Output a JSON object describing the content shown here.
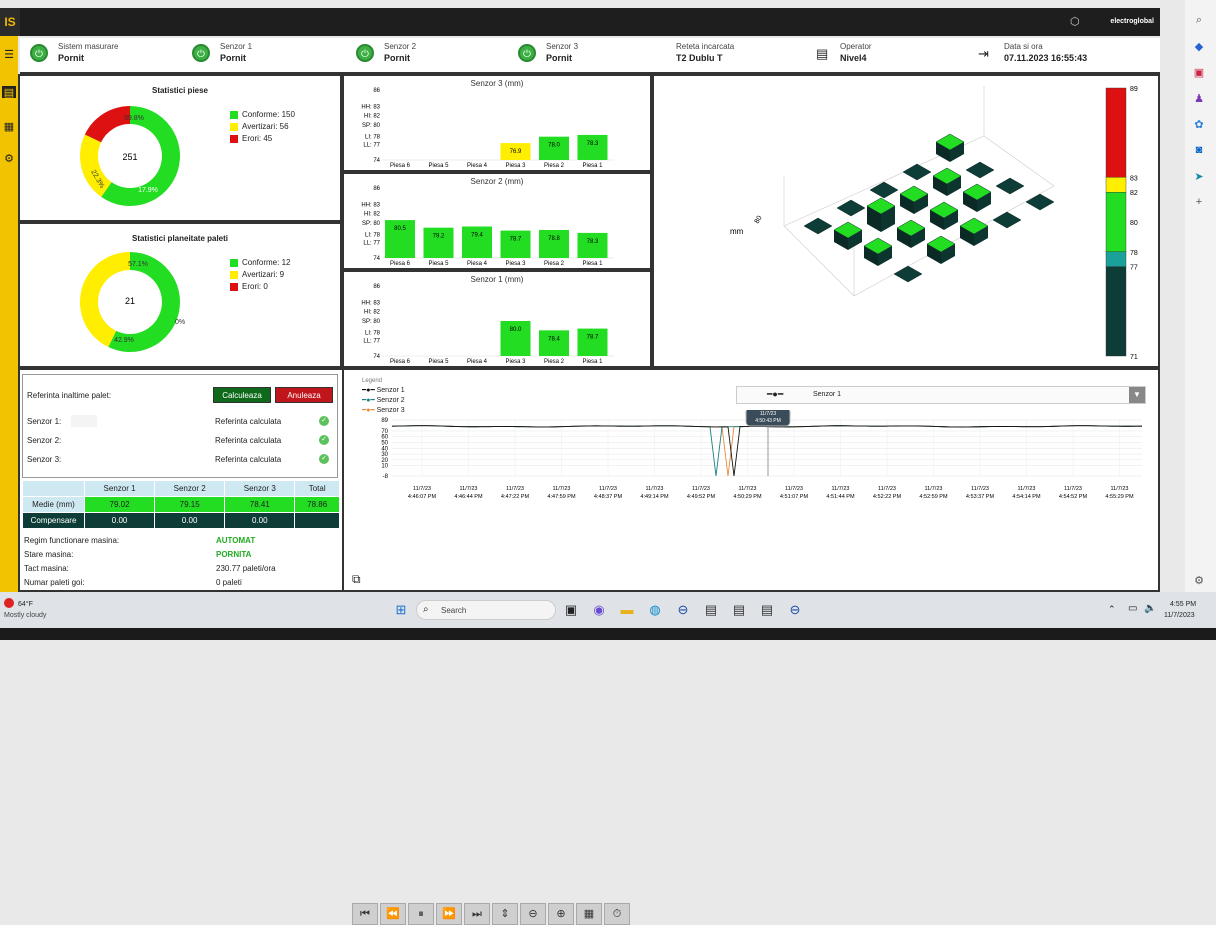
{
  "app": {
    "logo": "IS",
    "brand": "electroglobal"
  },
  "status": [
    {
      "label": "Sistem masurare",
      "value": "Pornit"
    },
    {
      "label": "Senzor 1",
      "value": "Pornit"
    },
    {
      "label": "Senzor 2",
      "value": "Pornit"
    },
    {
      "label": "Senzor 3",
      "value": "Pornit"
    },
    {
      "label": "Reteta incarcata",
      "value": "T2 Dublu T"
    },
    {
      "label": "Operator",
      "value": "Nivel4"
    },
    {
      "label": "Data si ora",
      "value": "07.11.2023 16:55:43"
    }
  ],
  "piese": {
    "title": "Statistici piese",
    "total": "251",
    "p1": "59.8%",
    "p2": "22.3%",
    "p3": "17.9%",
    "legend": [
      "Conforme: 150",
      "Avertizari: 56",
      "Erori: 45"
    ]
  },
  "paleti": {
    "title": "Statistici planeitate paleti",
    "total": "21",
    "p1": "57.1%",
    "p2": "42.9%",
    "p3": "0%",
    "legend": [
      "Conforme: 12",
      "Avertizari: 9",
      "Erori: 0"
    ]
  },
  "colors": {
    "green": "#22dd22",
    "yellow": "#ffee00",
    "red": "#dd1111",
    "dark": "#0d3d36",
    "teal": "#1aa19a"
  },
  "bars": {
    "yticks": [
      "86",
      "HH: 83",
      "HI: 82",
      "SP: 80",
      "LI: 78",
      "LL: 77",
      "74"
    ],
    "categories": [
      "Piesa 6",
      "Piesa 5",
      "Piesa 4",
      "Piesa 3",
      "Piesa 2",
      "Piesa 1"
    ],
    "s3": {
      "title": "Senzor 3 (mm)",
      "labels": [
        "",
        "",
        "",
        "76.9",
        "78.0",
        "78.3"
      ]
    },
    "s2": {
      "title": "Senzor 2 (mm)",
      "labels": [
        "80.5",
        "79.2",
        "79.4",
        "78.7",
        "78.8",
        "78.3"
      ]
    },
    "s1": {
      "title": "Senzor 1 (mm)",
      "labels": [
        "",
        "",
        "",
        "80.0",
        "78.4",
        "78.7"
      ]
    }
  },
  "chart_data": [
    {
      "type": "bar",
      "title": "Senzor 3 (mm)",
      "categories": [
        "Piesa 6",
        "Piesa 5",
        "Piesa 4",
        "Piesa 3",
        "Piesa 2",
        "Piesa 1"
      ],
      "values": [
        null,
        null,
        null,
        76.9,
        78.0,
        78.3
      ],
      "ylim": [
        74,
        86
      ]
    },
    {
      "type": "bar",
      "title": "Senzor 2 (mm)",
      "categories": [
        "Piesa 6",
        "Piesa 5",
        "Piesa 4",
        "Piesa 3",
        "Piesa 2",
        "Piesa 1"
      ],
      "values": [
        80.5,
        79.2,
        79.4,
        78.7,
        78.8,
        78.3
      ],
      "ylim": [
        74,
        86
      ]
    },
    {
      "type": "bar",
      "title": "Senzor 1 (mm)",
      "categories": [
        "Piesa 6",
        "Piesa 5",
        "Piesa 4",
        "Piesa 3",
        "Piesa 2",
        "Piesa 1"
      ],
      "values": [
        null,
        null,
        null,
        80.0,
        78.4,
        78.7
      ],
      "ylim": [
        74,
        86
      ]
    },
    {
      "type": "pie",
      "title": "Statistici piese",
      "labels": [
        "Conforme",
        "Avertizari",
        "Erori"
      ],
      "values": [
        150,
        56,
        45
      ]
    },
    {
      "type": "pie",
      "title": "Statistici planeitate paleti",
      "labels": [
        "Conforme",
        "Avertizari",
        "Erori"
      ],
      "values": [
        12,
        9,
        0
      ]
    }
  ],
  "scale3d": {
    "ylabel": "mm",
    "tick": "80",
    "colorbar": [
      "89",
      "83",
      "82",
      "80",
      "78",
      "77",
      "71"
    ]
  },
  "ref": {
    "title": "Referinta inaltime palet:",
    "calc": "Calculeaza",
    "cancel": "Anuleaza",
    "rows": [
      {
        "label": "Senzor 1:",
        "status": "Referinta calculata"
      },
      {
        "label": "Senzor 2:",
        "status": "Referinta calculata"
      },
      {
        "label": "Senzor 3:",
        "status": "Referinta calculata"
      }
    ]
  },
  "table": {
    "headers": [
      "",
      "Senzor 1",
      "Senzor 2",
      "Senzor 3",
      "Total"
    ],
    "medie": [
      "Medie (mm)",
      "79.02",
      "79.15",
      "78.41",
      "78.86"
    ],
    "comp": [
      "Compensare",
      "0.00",
      "0.00",
      "0.00",
      ""
    ]
  },
  "info": [
    {
      "label": "Regim functionare masina:",
      "value": "AUTOMAT"
    },
    {
      "label": "Stare masina:",
      "value": "PORNITA"
    },
    {
      "label": "Tact masina:",
      "value": "230.77 paleti/ora"
    },
    {
      "label": "Numar paleti goi:",
      "value": "0 paleti"
    }
  ],
  "trend": {
    "legend_title": "Legend",
    "series": [
      "Senzor 1",
      "Senzor 2",
      "Senzor 3"
    ],
    "select_label": "Senzor 1",
    "yticks": [
      "89",
      "70",
      "60",
      "50",
      "40",
      "30",
      "20",
      "10",
      "-8"
    ],
    "xdate": "11/7/23",
    "xtimes": [
      "4:46:07 PM",
      "4:46:44 PM",
      "4:47:22 PM",
      "4:47:59 PM",
      "4:48:37 PM",
      "4:49:14 PM",
      "4:49:52 PM",
      "4:50:29 PM",
      "4:51:07 PM",
      "4:51:44 PM",
      "4:52:22 PM",
      "4:52:59 PM",
      "4:53:37 PM",
      "4:54:14 PM",
      "4:54:52 PM",
      "4:55:29 PM"
    ],
    "tooltip_date": "11/7/23",
    "tooltip_time": "4:50:43 PM"
  },
  "taskbar": {
    "temp": "64°F",
    "weather": "Mostly cloudy",
    "search": "Search",
    "time": "4:55 PM",
    "date": "11/7/2023"
  }
}
